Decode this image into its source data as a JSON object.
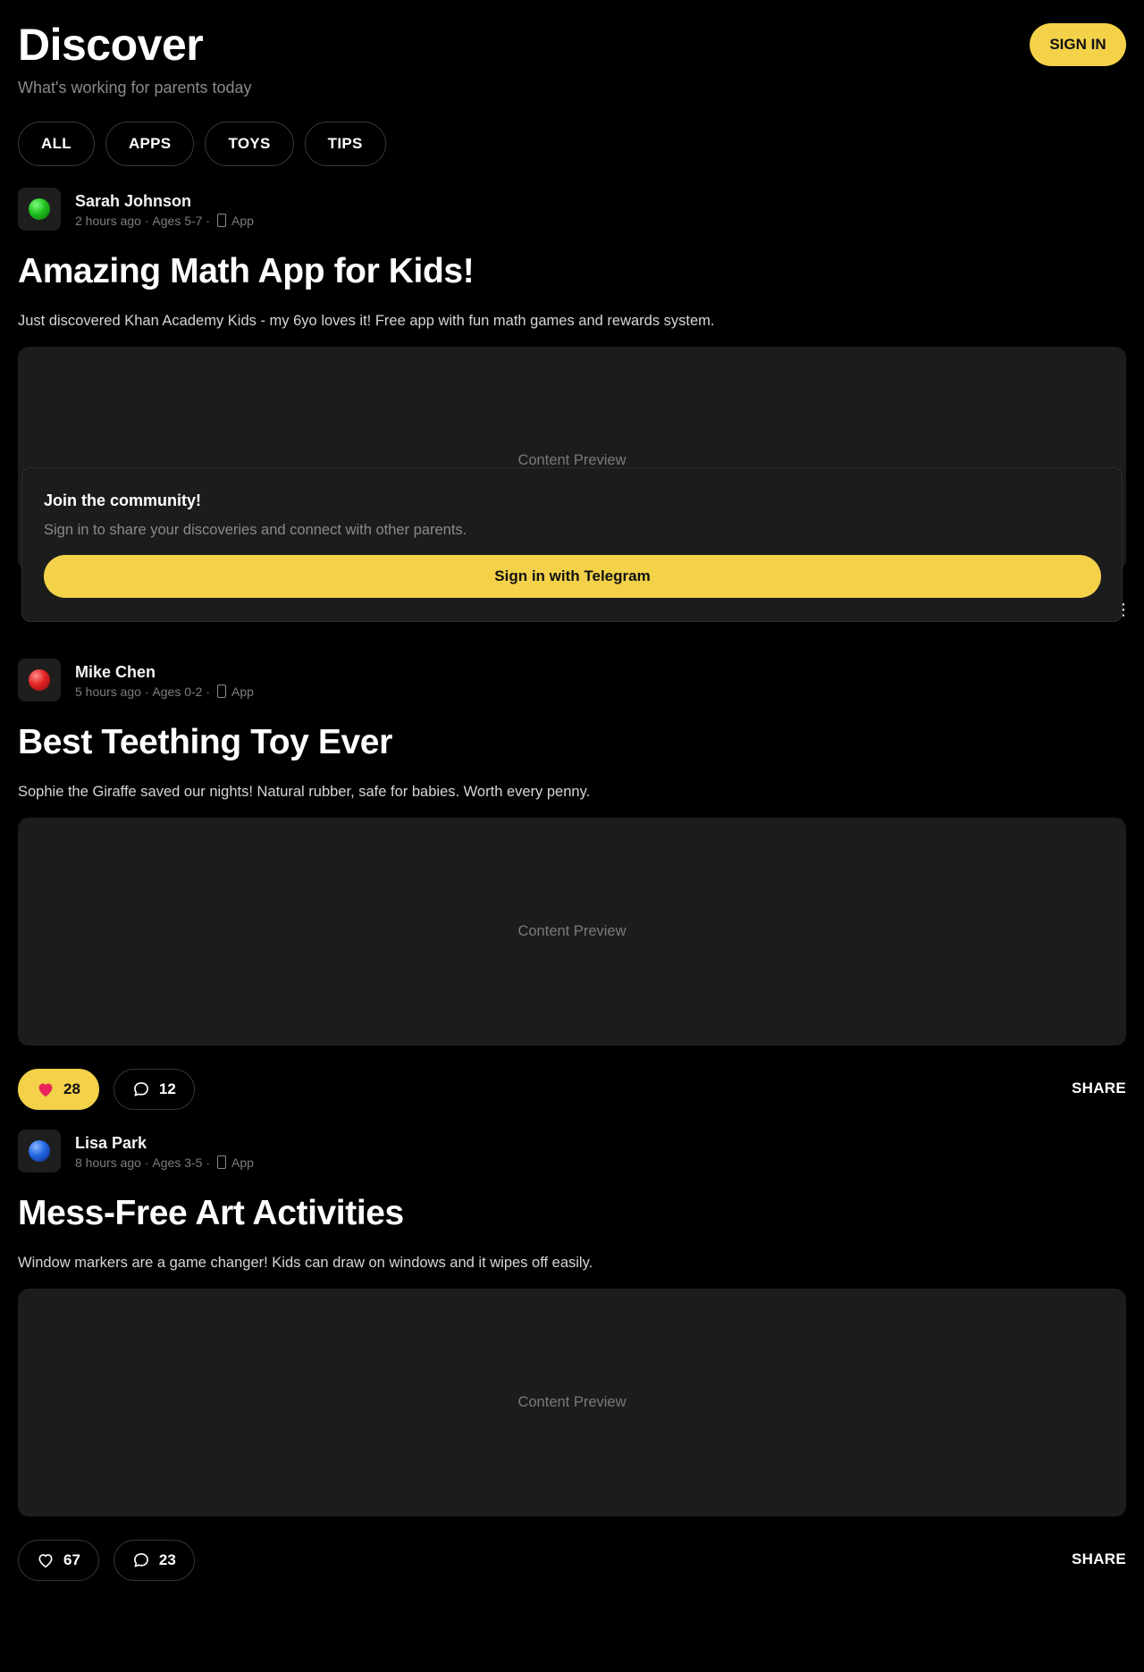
{
  "header": {
    "title": "Discover",
    "subtitle": "What's working for parents today",
    "signin_label": "SIGN IN"
  },
  "filters": [
    "ALL",
    "APPS",
    "TOYS",
    "TIPS"
  ],
  "posts": [
    {
      "author": "Sarah Johnson",
      "avatar_color": "#1fbf1f",
      "time": "2 hours ago",
      "ages": "Ages 5-7",
      "type": "App",
      "title": "Amazing Math App for Kids!",
      "text": "Just discovered Khan Academy Kids - my 6yo loves it! Free app with fun math games and rewards system.",
      "preview": "Content Preview"
    },
    {
      "author": "Mike Chen",
      "avatar_color": "#e02222",
      "time": "5 hours ago",
      "ages": "Ages 0-2",
      "type": "App",
      "title": "Best Teething Toy Ever",
      "text": "Sophie the Giraffe saved our nights! Natural rubber, safe for babies. Worth every penny.",
      "preview": "Content Preview",
      "likes": "28",
      "comments": "12",
      "liked": true,
      "share": "SHARE"
    },
    {
      "author": "Lisa Park",
      "avatar_color": "#2266e0",
      "time": "8 hours ago",
      "ages": "Ages 3-5",
      "type": "App",
      "title": "Mess-Free Art Activities",
      "text": "Window markers are a game changer! Kids can draw on windows and it wipes off easily.",
      "preview": "Content Preview",
      "likes": "67",
      "comments": "23",
      "liked": false,
      "share": "SHARE"
    }
  ],
  "signin_prompt": {
    "title": "Join the community!",
    "text": "Sign in to share your discoveries and connect with other parents.",
    "button": "Sign in with Telegram"
  },
  "colors": {
    "accent": "#f3d24a",
    "like_heart": "#e8245a"
  }
}
